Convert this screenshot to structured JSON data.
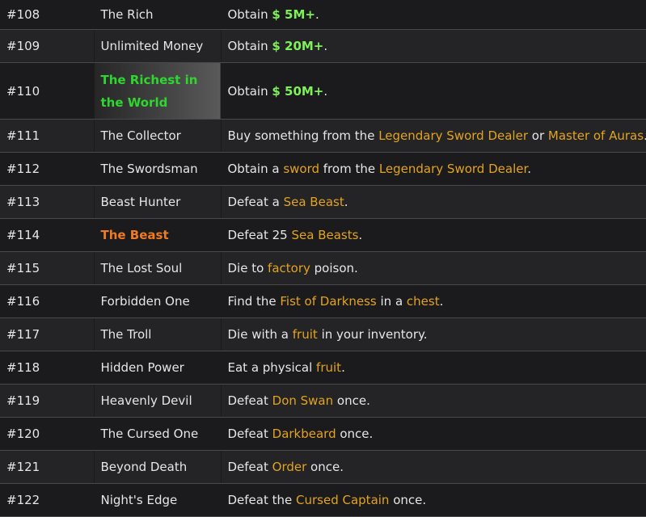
{
  "rows": [
    {
      "id": "#108",
      "title": "The Rich",
      "desc": [
        {
          "t": "Obtain "
        },
        {
          "t": "$ 5M+",
          "c": "money"
        },
        {
          "t": "."
        }
      ]
    },
    {
      "id": "#109",
      "title": "Unlimited Money",
      "desc": [
        {
          "t": "Obtain "
        },
        {
          "t": "$ 20M+",
          "c": "money"
        },
        {
          "t": "."
        }
      ]
    },
    {
      "id": "#110",
      "title": "The Richest in the World",
      "title_style": "green",
      "tall": true,
      "desc": [
        {
          "t": "Obtain "
        },
        {
          "t": "$ 50M+",
          "c": "money"
        },
        {
          "t": "."
        }
      ]
    },
    {
      "id": "#111",
      "title": "The Collector",
      "desc": [
        {
          "t": "Buy something from the "
        },
        {
          "t": "Legendary Sword Dealer",
          "c": "link"
        },
        {
          "t": " or "
        },
        {
          "t": "Master of Auras",
          "c": "link"
        },
        {
          "t": "."
        }
      ]
    },
    {
      "id": "#112",
      "title": "The Swordsman",
      "desc": [
        {
          "t": "Obtain a "
        },
        {
          "t": "sword",
          "c": "link"
        },
        {
          "t": " from the "
        },
        {
          "t": "Legendary Sword Dealer",
          "c": "link"
        },
        {
          "t": "."
        }
      ]
    },
    {
      "id": "#113",
      "title": "Beast Hunter",
      "desc": [
        {
          "t": "Defeat a "
        },
        {
          "t": "Sea Beast",
          "c": "link"
        },
        {
          "t": "."
        }
      ]
    },
    {
      "id": "#114",
      "title": "The Beast",
      "title_style": "orange",
      "desc": [
        {
          "t": "Defeat 25 "
        },
        {
          "t": "Sea Beasts",
          "c": "link"
        },
        {
          "t": "."
        }
      ]
    },
    {
      "id": "#115",
      "title": "The Lost Soul",
      "desc": [
        {
          "t": "Die to "
        },
        {
          "t": "factory",
          "c": "link"
        },
        {
          "t": " poison."
        }
      ]
    },
    {
      "id": "#116",
      "title": "Forbidden One",
      "desc": [
        {
          "t": "Find the "
        },
        {
          "t": "Fist of Darkness",
          "c": "link"
        },
        {
          "t": " in a "
        },
        {
          "t": "chest",
          "c": "link"
        },
        {
          "t": "."
        }
      ]
    },
    {
      "id": "#117",
      "title": "The Troll",
      "desc": [
        {
          "t": "Die with a "
        },
        {
          "t": "fruit",
          "c": "link"
        },
        {
          "t": " in your inventory."
        }
      ]
    },
    {
      "id": "#118",
      "title": "Hidden Power",
      "desc": [
        {
          "t": "Eat a physical "
        },
        {
          "t": "fruit",
          "c": "link"
        },
        {
          "t": "."
        }
      ]
    },
    {
      "id": "#119",
      "title": "Heavenly Devil",
      "desc": [
        {
          "t": "Defeat "
        },
        {
          "t": "Don Swan",
          "c": "link"
        },
        {
          "t": " once."
        }
      ]
    },
    {
      "id": "#120",
      "title": "The Cursed One",
      "desc": [
        {
          "t": "Defeat "
        },
        {
          "t": "Darkbeard",
          "c": "link"
        },
        {
          "t": " once."
        }
      ]
    },
    {
      "id": "#121",
      "title": "Beyond Death",
      "desc": [
        {
          "t": "Defeat "
        },
        {
          "t": "Order",
          "c": "link"
        },
        {
          "t": " once."
        }
      ]
    },
    {
      "id": "#122",
      "title": "Night's Edge",
      "desc": [
        {
          "t": "Defeat the "
        },
        {
          "t": "Cursed Captain",
          "c": "link"
        },
        {
          "t": " once."
        }
      ]
    }
  ]
}
